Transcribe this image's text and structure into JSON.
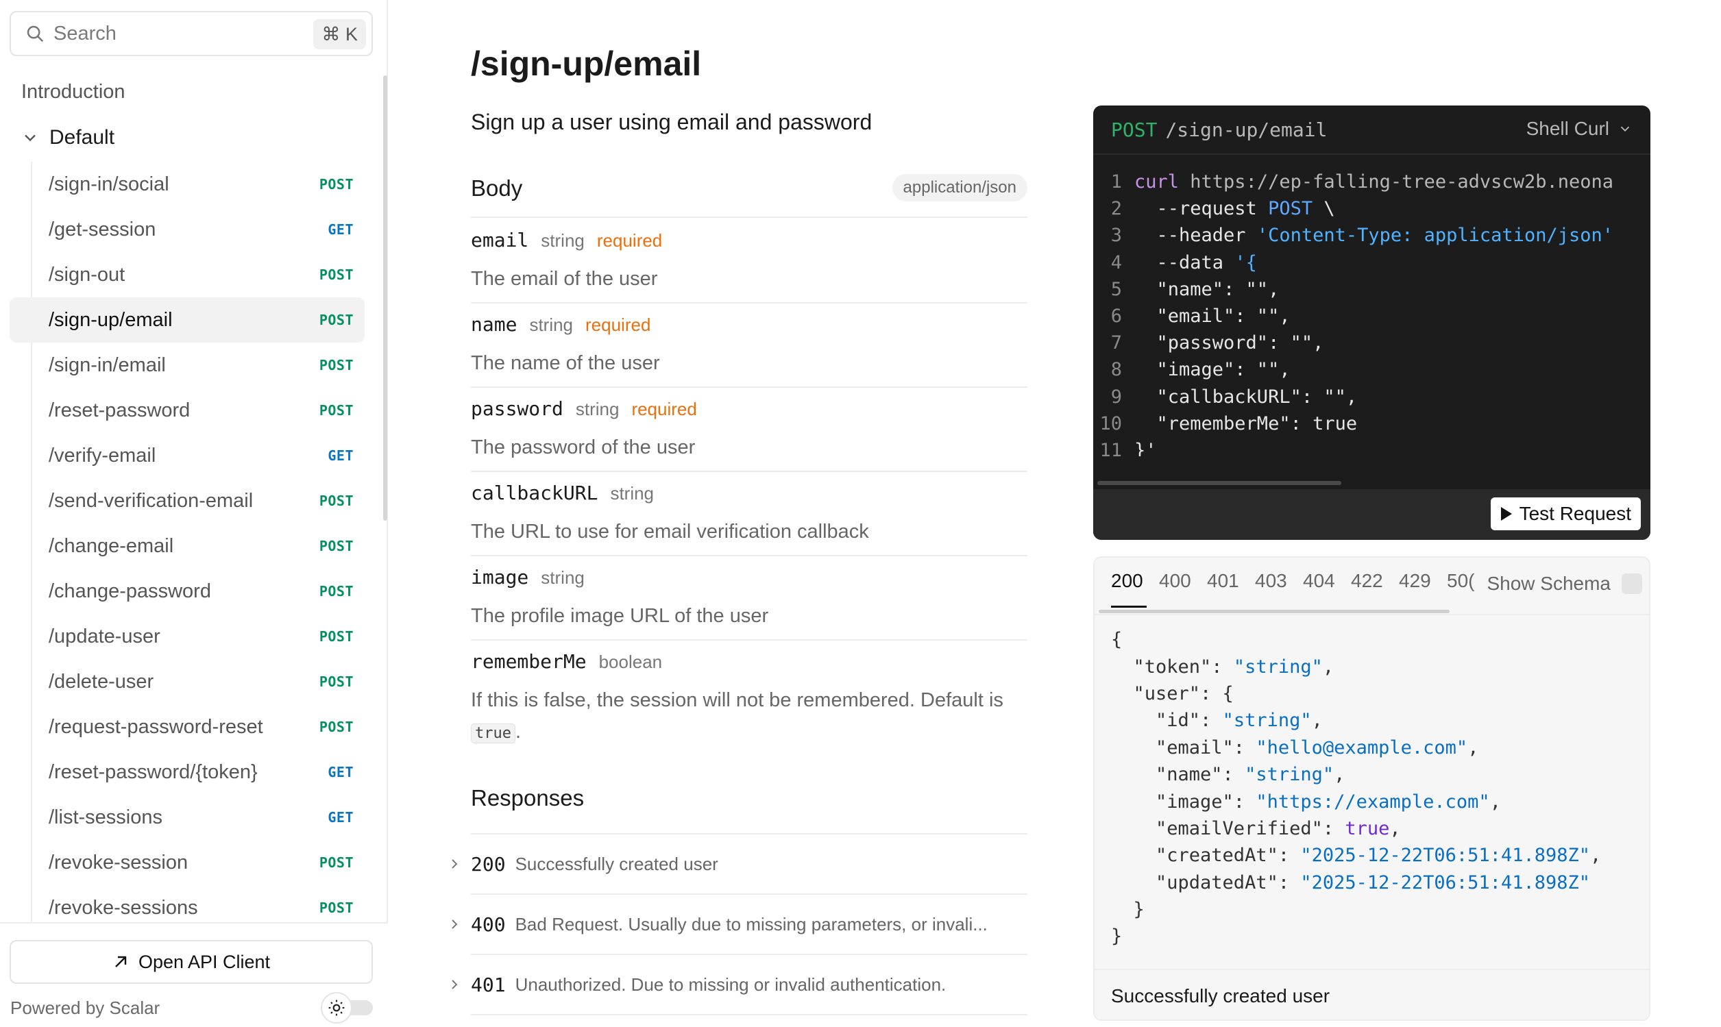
{
  "sidebar": {
    "search_placeholder": "Search",
    "search_shortcut": "⌘ K",
    "intro_label": "Introduction",
    "group_label": "Default",
    "items": [
      {
        "label": "/sign-in/social",
        "method": "POST"
      },
      {
        "label": "/get-session",
        "method": "GET"
      },
      {
        "label": "/sign-out",
        "method": "POST"
      },
      {
        "label": "/sign-up/email",
        "method": "POST",
        "active": true
      },
      {
        "label": "/sign-in/email",
        "method": "POST"
      },
      {
        "label": "/reset-password",
        "method": "POST"
      },
      {
        "label": "/verify-email",
        "method": "GET"
      },
      {
        "label": "/send-verification-email",
        "method": "POST"
      },
      {
        "label": "/change-email",
        "method": "POST"
      },
      {
        "label": "/change-password",
        "method": "POST"
      },
      {
        "label": "/update-user",
        "method": "POST"
      },
      {
        "label": "/delete-user",
        "method": "POST"
      },
      {
        "label": "/request-password-reset",
        "method": "POST"
      },
      {
        "label": "/reset-password/{token}",
        "method": "GET"
      },
      {
        "label": "/list-sessions",
        "method": "GET"
      },
      {
        "label": "/revoke-session",
        "method": "POST"
      },
      {
        "label": "/revoke-sessions",
        "method": "POST"
      }
    ],
    "open_client_label": "Open API Client",
    "powered_by": "Powered by Scalar"
  },
  "main": {
    "title": "/sign-up/email",
    "description": "Sign up a user using email and password",
    "body_title": "Body",
    "content_type": "application/json",
    "params": [
      {
        "name": "email",
        "type": "string",
        "required": "required",
        "description": "The email of the user"
      },
      {
        "name": "name",
        "type": "string",
        "required": "required",
        "description": "The name of the user"
      },
      {
        "name": "password",
        "type": "string",
        "required": "required",
        "description": "The password of the user"
      },
      {
        "name": "callbackURL",
        "type": "string",
        "required": "",
        "description": "The URL to use for email verification callback"
      },
      {
        "name": "image",
        "type": "string",
        "required": "",
        "description": "The profile image URL of the user"
      },
      {
        "name": "rememberMe",
        "type": "boolean",
        "required": "",
        "description": "If this is false, the session will not be remembered. Default is",
        "description_code": "true",
        "description_end": "."
      }
    ],
    "responses_title": "Responses",
    "responses": [
      {
        "code": "200",
        "description": "Successfully created user"
      },
      {
        "code": "400",
        "description": "Bad Request. Usually due to missing parameters, or invali..."
      },
      {
        "code": "401",
        "description": "Unauthorized. Due to missing or invalid authentication."
      }
    ]
  },
  "request_panel": {
    "method": "POST",
    "path": "/sign-up/email",
    "language": "Shell Curl",
    "line_numbers": [
      "1",
      "2",
      "3",
      "4",
      "5",
      "6",
      "7",
      "8",
      "9",
      "10",
      "11"
    ],
    "code": {
      "l1_cmd": "curl",
      "l1_url": " https://ep-falling-tree-advscw2b.neona",
      "l2_flag": "  --request ",
      "l2_val": "POST",
      "l2_end": " \\",
      "l3_flag": "  --header ",
      "l3_val": "'Content-Type: application/json'",
      "l4_flag": "  --data ",
      "l4_val": "'{",
      "l5": "  \"name\": \"\",",
      "l6": "  \"email\": \"\",",
      "l7": "  \"password\": \"\",",
      "l8": "  \"image\": \"\",",
      "l9": "  \"callbackURL\": \"\",",
      "l10": "  \"rememberMe\": true",
      "l11": "}'"
    },
    "test_button": "Test Request"
  },
  "response_panel": {
    "tabs": [
      "200",
      "400",
      "401",
      "403",
      "404",
      "422",
      "429",
      "50("
    ],
    "active_tab": "200",
    "show_schema_label": "Show Schema",
    "json": {
      "open": "{",
      "token_key": "  \"token\": ",
      "token_val": "\"string\"",
      "user_key": "  \"user\": {",
      "id_key": "    \"id\": ",
      "id_val": "\"string\"",
      "email_key": "    \"email\": ",
      "email_val": "\"hello@example.com\"",
      "name_key": "    \"name\": ",
      "name_val": "\"string\"",
      "image_key": "    \"image\": ",
      "image_val": "\"https://example.com\"",
      "ev_key": "    \"emailVerified\": ",
      "ev_val": "true",
      "ca_key": "    \"createdAt\": ",
      "ca_val": "\"2025-12-22T06:51:41.898Z\"",
      "ua_key": "    \"updatedAt\": ",
      "ua_val": "\"2025-12-22T06:51:41.898Z\"",
      "user_close": "  }",
      "close": "}"
    },
    "footer": "Successfully created user"
  },
  "colors": {
    "post": "#069061",
    "get": "#0a76c2",
    "required": "#e8700e"
  }
}
